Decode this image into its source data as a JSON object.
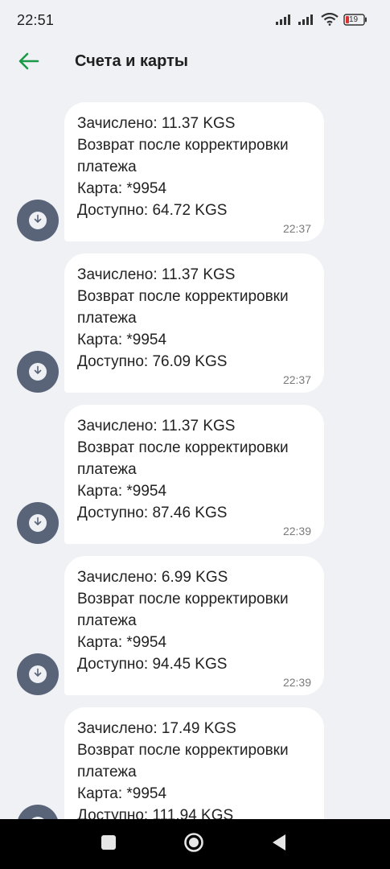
{
  "status_bar": {
    "time": "22:51",
    "battery_level": "19",
    "icons": [
      "signal-icon",
      "signal-icon",
      "wifi-icon",
      "battery-icon"
    ]
  },
  "header": {
    "title": "Счета и карты",
    "back_icon": "arrow-left-icon",
    "accent_color": "#1a9a48"
  },
  "messages": [
    {
      "line1": "Зачислено: 11.37 KGS",
      "line2": "Возврат после корректировки",
      "line3": "платежа",
      "line4": "Карта: *9954",
      "line5": "Доступно: 64.72 KGS",
      "time": "22:37"
    },
    {
      "line1": "Зачислено: 11.37 KGS",
      "line2": "Возврат после корректировки",
      "line3": "платежа",
      "line4": "Карта: *9954",
      "line5": "Доступно: 76.09 KGS",
      "time": "22:37"
    },
    {
      "line1": "Зачислено: 11.37 KGS",
      "line2": "Возврат после корректировки",
      "line3": "платежа",
      "line4": "Карта: *9954",
      "line5": "Доступно: 87.46 KGS",
      "time": "22:39"
    },
    {
      "line1": "Зачислено: 6.99 KGS",
      "line2": "Возврат после корректировки",
      "line3": "платежа",
      "line4": "Карта: *9954",
      "line5": "Доступно: 94.45 KGS",
      "time": "22:39"
    },
    {
      "line1": "Зачислено: 17.49 KGS",
      "line2": "Возврат после корректировки",
      "line3": "платежа",
      "line4": "Карта: *9954",
      "line5": "Доступно: 111.94 KGS",
      "time": ""
    }
  ],
  "nav_bar": {
    "buttons": [
      "recents-square-icon",
      "home-circle-icon",
      "back-triangle-icon"
    ]
  }
}
